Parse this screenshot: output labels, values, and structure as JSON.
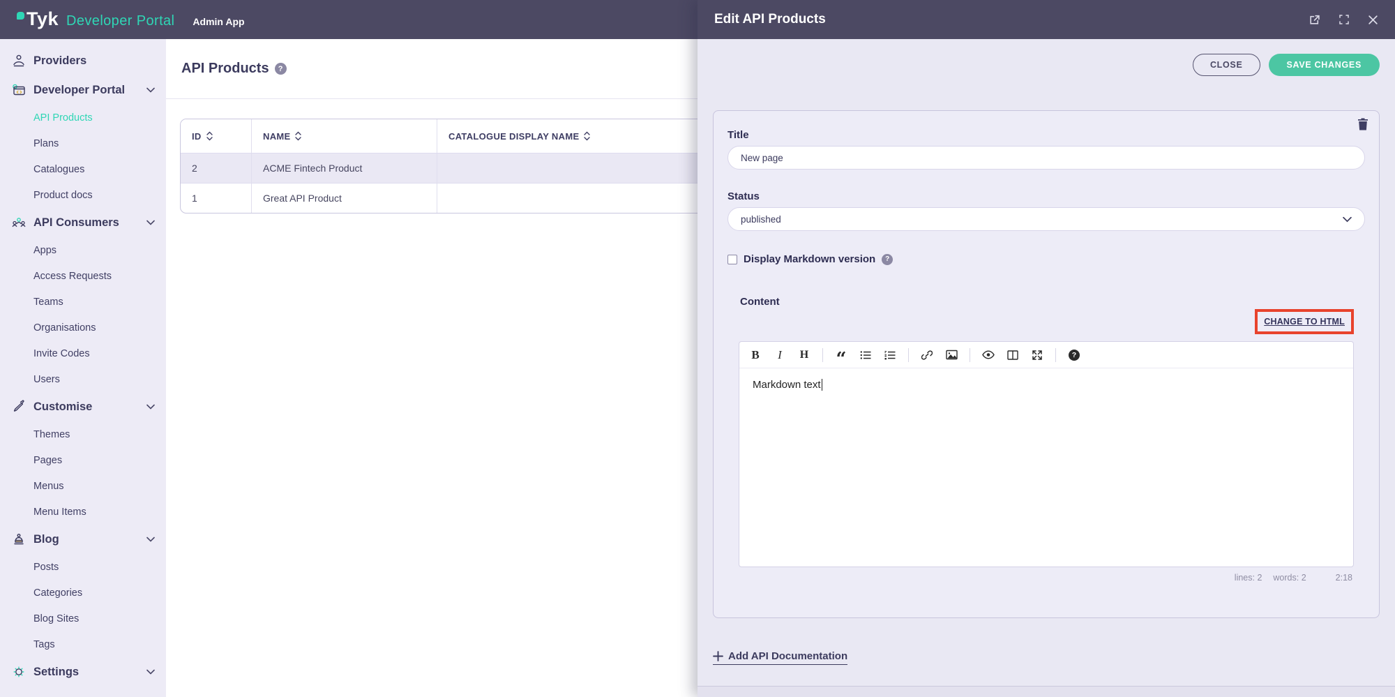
{
  "topbar": {
    "logo": "Tyk",
    "product": "Developer Portal",
    "app": "Admin App"
  },
  "sidebar": {
    "active_item": "API Products",
    "sections": [
      {
        "label": "Providers",
        "children": []
      },
      {
        "label": "Developer Portal",
        "children": [
          {
            "label": "API Products"
          },
          {
            "label": "Plans"
          },
          {
            "label": "Catalogues"
          },
          {
            "label": "Product docs"
          }
        ]
      },
      {
        "label": "API Consumers",
        "children": [
          {
            "label": "Apps"
          },
          {
            "label": "Access Requests"
          },
          {
            "label": "Teams"
          },
          {
            "label": "Organisations"
          },
          {
            "label": "Invite Codes"
          },
          {
            "label": "Users"
          }
        ]
      },
      {
        "label": "Customise",
        "children": [
          {
            "label": "Themes"
          },
          {
            "label": "Pages"
          },
          {
            "label": "Menus"
          },
          {
            "label": "Menu Items"
          }
        ]
      },
      {
        "label": "Blog",
        "children": [
          {
            "label": "Posts"
          },
          {
            "label": "Categories"
          },
          {
            "label": "Blog Sites"
          },
          {
            "label": "Tags"
          }
        ]
      },
      {
        "label": "Settings",
        "children": []
      }
    ]
  },
  "main": {
    "title": "API Products",
    "help_glyph": "?",
    "table": {
      "headers": [
        {
          "label": "ID"
        },
        {
          "label": "NAME"
        },
        {
          "label": "CATALOGUE DISPLAY NAME"
        }
      ],
      "rows": [
        {
          "id": "2",
          "name": "ACME Fintech Product",
          "catalogue": ""
        },
        {
          "id": "1",
          "name": "Great API Product",
          "catalogue": ""
        }
      ]
    }
  },
  "drawer": {
    "title": "Edit API Products",
    "close_button": "CLOSE",
    "save_button": "SAVE CHANGES",
    "form": {
      "title_label": "Title",
      "title_value": "New page",
      "status_label": "Status",
      "status_value": "published",
      "markdown_checkbox_label": "Display Markdown version",
      "help_glyph": "?",
      "content_label": "Content",
      "change_to_html": "CHANGE TO HTML"
    },
    "editor": {
      "toolbar": {
        "bold_glyph": "B",
        "italic_glyph": "I",
        "heading_glyph": "H",
        "quote_glyph": "“",
        "help_glyph": "?"
      },
      "text": "Markdown text",
      "stats": {
        "lines": "lines: 2",
        "words": "words: 2",
        "position": "2:18"
      }
    },
    "add_api_doc": "Add API Documentation"
  },
  "colors": {
    "topbar_bg": "#4c4963",
    "brand_teal": "#2fd6b5",
    "save_button": "#4cc6a3",
    "sidebar_bg": "#edebf6",
    "drawer_bg": "#e9e8f3",
    "annotation_red": "#e8432d",
    "text_navy": "#3c3b5e"
  }
}
